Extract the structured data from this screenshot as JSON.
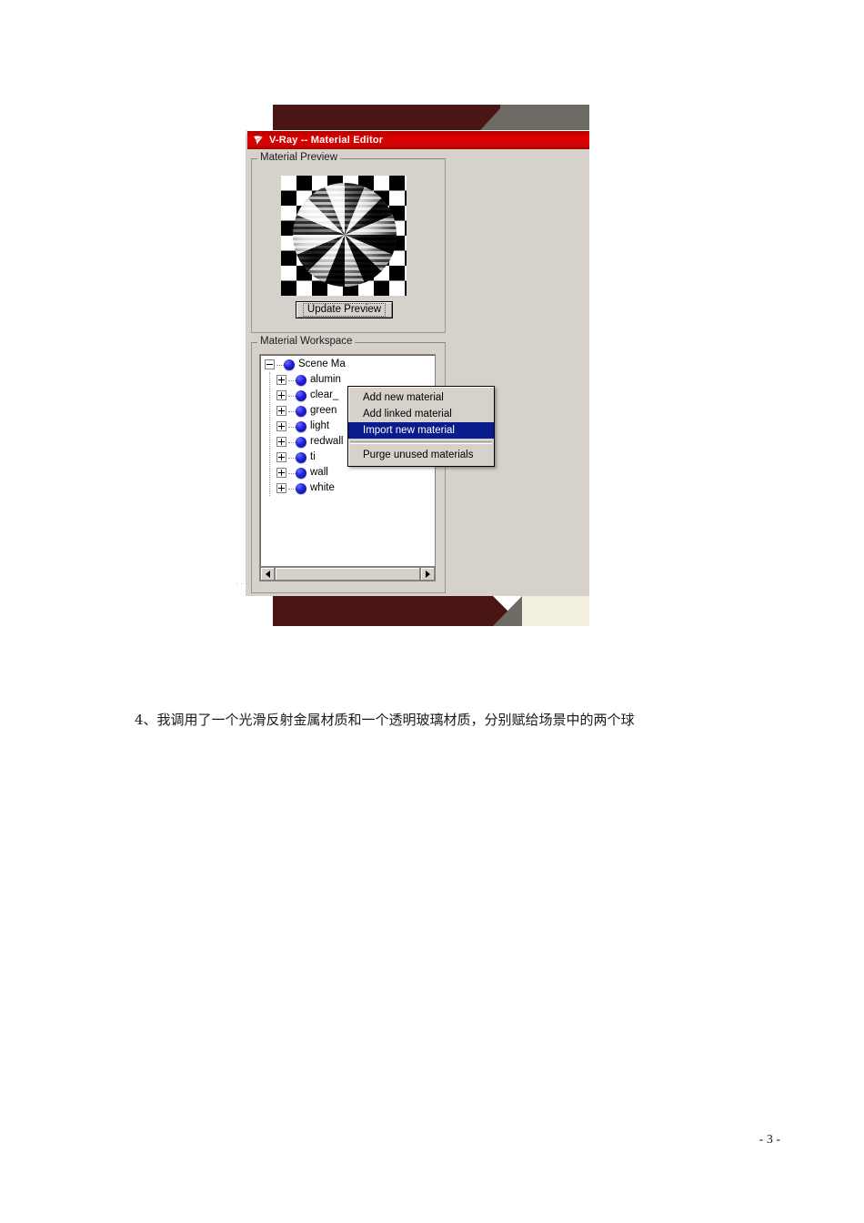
{
  "document": {
    "paragraph": "4、我调用了一个光滑反射金属材质和一个透明玻璃材质，分别赋给场景中的两个球",
    "page_number": "- 3 -"
  },
  "screenshot": {
    "window": {
      "title": "V-Ray -- Material Editor",
      "title_icon": "vray-logo-icon",
      "titlebar_color": "#cc0000"
    },
    "material_preview": {
      "legend": "Material Preview",
      "preview_image": "checkered-sphere-preview",
      "update_button": "Update Preview"
    },
    "material_workspace": {
      "legend": "Material Workspace",
      "tree": [
        {
          "label": "Scene Ma",
          "expander": "minus",
          "level": 0,
          "icon": "material-sphere-icon",
          "selected": true
        },
        {
          "label": "alumin",
          "expander": "plus",
          "level": 1,
          "icon": "material-sphere-icon",
          "selected": false
        },
        {
          "label": "clear_",
          "expander": "plus",
          "level": 1,
          "icon": "material-sphere-icon",
          "selected": false
        },
        {
          "label": "green",
          "expander": "plus",
          "level": 1,
          "icon": "material-sphere-icon",
          "selected": false
        },
        {
          "label": "light",
          "expander": "plus",
          "level": 1,
          "icon": "material-sphere-icon",
          "selected": false
        },
        {
          "label": "redwall",
          "expander": "plus",
          "level": 1,
          "icon": "material-sphere-icon",
          "selected": false
        },
        {
          "label": "ti",
          "expander": "plus",
          "level": 1,
          "icon": "material-sphere-icon",
          "selected": false
        },
        {
          "label": "wall",
          "expander": "plus",
          "level": 1,
          "icon": "material-sphere-icon",
          "selected": false
        },
        {
          "label": "white",
          "expander": "plus",
          "level": 1,
          "icon": "material-sphere-icon",
          "selected": false
        }
      ],
      "scrollbar": {
        "left_arrow": "scroll-left-icon",
        "right_arrow": "scroll-right-icon"
      }
    },
    "context_menu": {
      "items": [
        {
          "label": "Add new material",
          "highlighted": false
        },
        {
          "label": "Add linked material",
          "highlighted": false
        },
        {
          "label": "Import new material",
          "highlighted": true
        },
        {
          "label": "Purge unused materials",
          "highlighted": false
        }
      ],
      "highlight_color": "#0a1b8c"
    }
  }
}
